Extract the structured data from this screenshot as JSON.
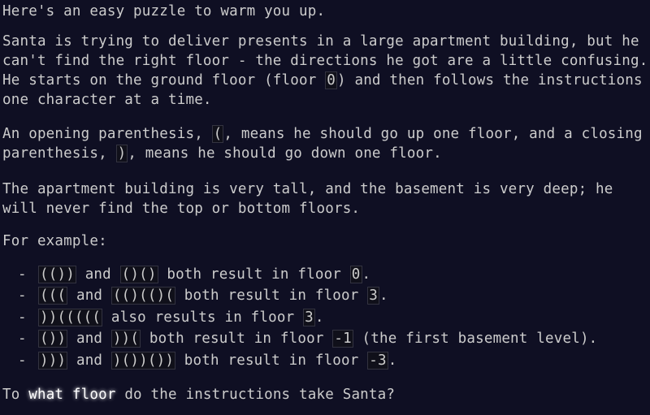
{
  "intro": "Here's an easy puzzle to warm you up.",
  "santa": {
    "text_before": "Santa is trying to deliver presents in a large apartment building, but he can't find the right floor - the directions he got are a little confusing. He starts on the ground floor (floor ",
    "code": "0",
    "text_after": ") and then follows the instructions one character at a time."
  },
  "parens": {
    "text1": "An opening parenthesis, ",
    "code1": "(",
    "text2": ", means he should go up one floor, and a closing parenthesis, ",
    "code2": ")",
    "text3": ", means he should go down one floor."
  },
  "tall": "The apartment building is very tall, and the basement is very deep; he will never find the top or bottom floors.",
  "for_example": "For example:",
  "examples": [
    {
      "a": "(())",
      "join": " and ",
      "b": "()()",
      "tail": " both result in floor ",
      "res": "0",
      "after": "."
    },
    {
      "a": "(((",
      "join": " and ",
      "b": "(()(()(",
      "tail": " both result in floor ",
      "res": "3",
      "after": "."
    },
    {
      "a": "))(((((",
      "join": "",
      "b": "",
      "tail": " also results in floor ",
      "res": "3",
      "after": "."
    },
    {
      "a": "())",
      "join": " and ",
      "b": "))(",
      "tail": " both result in floor ",
      "res": "-1",
      "after": " (the first basement level)."
    },
    {
      "a": ")))",
      "join": " and ",
      "b": ")())())",
      "tail": " both result in floor ",
      "res": "-3",
      "after": "."
    }
  ],
  "dash": "-",
  "question": {
    "before": "To ",
    "emph": "what floor",
    "after": " do the instructions take Santa?"
  }
}
